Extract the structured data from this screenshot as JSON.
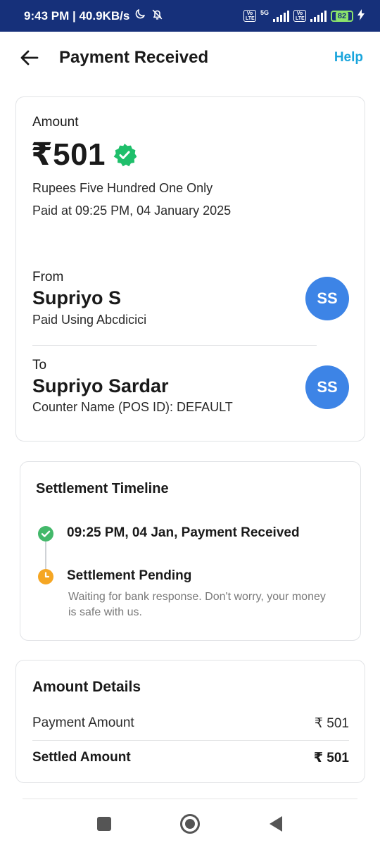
{
  "status_bar": {
    "time_speed": "9:43 PM | 40.9KB/s",
    "network_5g": "5G",
    "volte": [
      "Vo",
      "LTE"
    ],
    "battery": "82"
  },
  "header": {
    "title": "Payment Received",
    "help_label": "Help"
  },
  "payment": {
    "amount_label": "Amount",
    "amount": "₹501",
    "amount_words": "Rupees Five Hundred One Only",
    "paid_at": "Paid at 09:25 PM, 04 January 2025"
  },
  "from": {
    "label": "From",
    "name": "Supriyo S",
    "detail": "Paid Using Abcdicici",
    "initials": "SS"
  },
  "to": {
    "label": "To",
    "name": "Supriyo Sardar",
    "detail": "Counter Name (POS ID): DEFAULT",
    "initials": "SS"
  },
  "timeline": {
    "title": "Settlement Timeline",
    "events": [
      {
        "label": "09:25 PM, 04 Jan, Payment Received",
        "status": "done"
      },
      {
        "label": "Settlement Pending",
        "status": "pending",
        "note": "Waiting for bank response. Don't worry, your money is safe with us."
      }
    ]
  },
  "details": {
    "title": "Amount Details",
    "rows": [
      {
        "label": "Payment Amount",
        "value": "₹ 501"
      },
      {
        "label": "Settled Amount",
        "value": "₹ 501"
      }
    ]
  },
  "colors": {
    "status_bar_bg": "#16307a",
    "accent_link": "#1aa5dc",
    "verified_green": "#1fbf6b",
    "done_green": "#43b86a",
    "pending_orange": "#f5a623",
    "avatar_blue": "#3d84e6"
  },
  "icons": {
    "back": "arrow-left-icon",
    "verified": "verified-badge-icon",
    "done": "check-circle-icon",
    "pending": "clock-icon",
    "nav": [
      "recents-square-icon",
      "home-circle-icon",
      "back-triangle-icon"
    ]
  }
}
